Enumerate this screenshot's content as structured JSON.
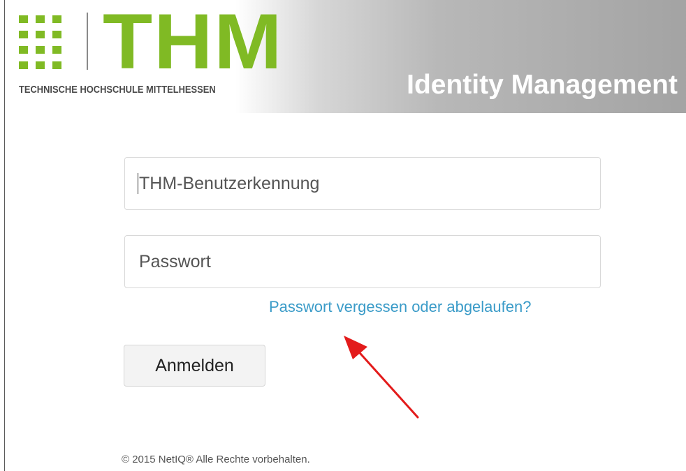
{
  "header": {
    "logo_letters": "THM",
    "logo_subtitle": "TECHNISCHE HOCHSCHULE MITTELHESSEN",
    "title": "Identity Management",
    "colors": {
      "logo_green": "#80ba24",
      "logo_gray": "#4a4a4a"
    }
  },
  "form": {
    "username_placeholder": "THM-Benutzerkennung",
    "username_value": "",
    "password_placeholder": "Passwort",
    "password_value": "",
    "forgot_link": "Passwort vergessen oder abgelaufen?",
    "login_button": "Anmelden"
  },
  "annotation": {
    "icon": "red-arrow-icon",
    "color": "#e31b1b"
  },
  "footer": {
    "copyright": "© 2015 NetIQ® Alle Rechte vorbehalten."
  }
}
